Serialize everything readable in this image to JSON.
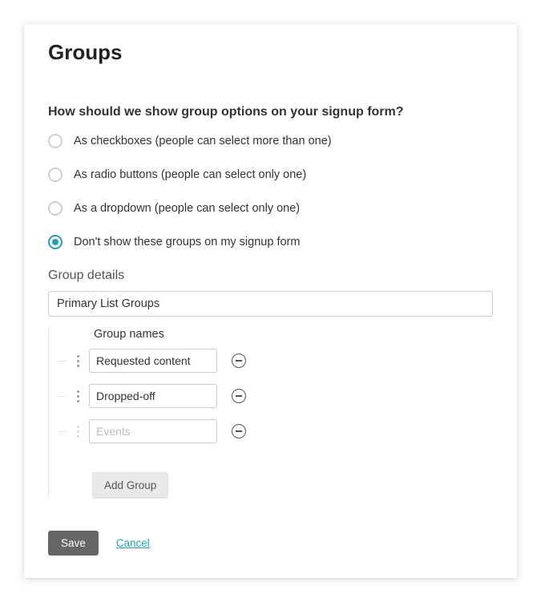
{
  "title": "Groups",
  "question": "How should we show group options on your signup form?",
  "options": {
    "checkboxes": "As checkboxes (people can select more than one)",
    "radio": "As radio buttons (people can select only one)",
    "dropdown": "As a dropdown (people can select only one)",
    "hidden": "Don't show these groups on my signup form"
  },
  "details": {
    "section_label": "Group details",
    "name_value": "Primary List Groups",
    "column_header": "Group names",
    "rows": {
      "r0": "Requested content",
      "r1": "Dropped-off"
    },
    "new_placeholder": "Events",
    "add_label": "Add Group"
  },
  "footer": {
    "save": "Save",
    "cancel": "Cancel"
  }
}
